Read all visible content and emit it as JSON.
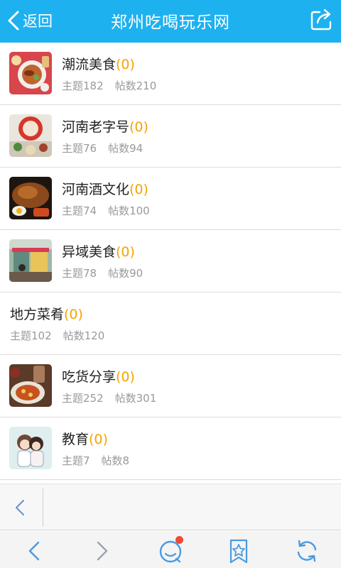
{
  "header": {
    "back_label": "返回",
    "title": "郑州吃喝玩乐网"
  },
  "forums": [
    {
      "name": "潮流美食",
      "count": "(0)",
      "topics": "主题182",
      "posts": "帖数210",
      "thumb": "food-plate"
    },
    {
      "name": "河南老字号",
      "count": "(0)",
      "topics": "主题76",
      "posts": "帖数94",
      "thumb": "hotpot"
    },
    {
      "name": "河南酒文化",
      "count": "(0)",
      "topics": "主题74",
      "posts": "帖数100",
      "thumb": "roast-dish"
    },
    {
      "name": "异域美食",
      "count": "(0)",
      "topics": "主题78",
      "posts": "帖数90",
      "thumb": "food-stall"
    },
    {
      "name": "地方菜肴",
      "count": "(0)",
      "topics": "主题102",
      "posts": "帖数120",
      "thumb": ""
    },
    {
      "name": "吃货分享",
      "count": "(0)",
      "topics": "主题252",
      "posts": "帖数301",
      "thumb": "pizza-table"
    },
    {
      "name": "教育",
      "count": "(0)",
      "topics": "主题7",
      "posts": "帖数8",
      "thumb": "cartoon-couple"
    }
  ],
  "toolbar": {
    "icons": [
      "back-arrow-icon",
      "forward-arrow-icon",
      "chat-icon",
      "bookmark-star-icon",
      "refresh-icon"
    ],
    "notification": true
  },
  "colors": {
    "header_bg": "#1eb1f0",
    "count_accent": "#f5a300",
    "meta_text": "#9a9a9a",
    "badge": "#ef4a34"
  }
}
